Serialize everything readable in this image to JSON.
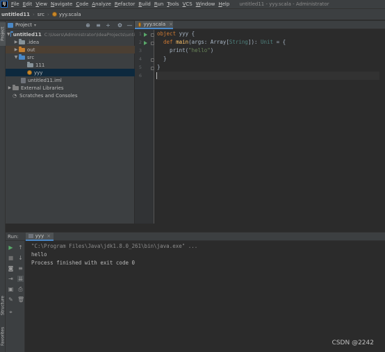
{
  "menubar": {
    "app_icon": "intellij-logo",
    "items": [
      "File",
      "Edit",
      "View",
      "Navigate",
      "Code",
      "Analyze",
      "Refactor",
      "Build",
      "Run",
      "Tools",
      "VCS",
      "Window",
      "Help"
    ],
    "window_title": "untitled11 - yyy.scala - Administrator"
  },
  "breadcrumb": {
    "project": "untitled11",
    "folder": "src",
    "file": "yyy.scala"
  },
  "left_strip": {
    "project_tab": "Project",
    "structure_tab": "Structure",
    "favorites_tab": "Favorites"
  },
  "project_panel": {
    "title": "Project",
    "tree": [
      {
        "label": "untitled11",
        "path": "C:\\Users\\Administrator\\IdeaProjects\\unti"
      },
      {
        "label": ".idea"
      },
      {
        "label": "out"
      },
      {
        "label": "src"
      },
      {
        "label": "111"
      },
      {
        "label": "yyy"
      },
      {
        "label": "untitled11.iml"
      },
      {
        "label": "External Libraries"
      },
      {
        "label": "Scratches and Consoles"
      }
    ]
  },
  "editor": {
    "tab_label": "yyy.scala",
    "line_numbers": [
      "1",
      "2",
      "3",
      "4",
      "5",
      "6"
    ],
    "code": {
      "l1_kw": "object",
      "l1_rest": " yyy {",
      "l2_indent": "  ",
      "l2_kw": "def",
      "l2_sp": " ",
      "l2_fn": "main",
      "l2_a": "(args: Array[",
      "l2_type": "String",
      "l2_b": "]): ",
      "l2_unit": "Unit",
      "l2_c": " = {",
      "l3_a": "    print(",
      "l3_str": "\"hello\"",
      "l3_b": ")",
      "l4": "  }",
      "l5": "}",
      "l6": ""
    }
  },
  "run_panel": {
    "label": "Run:",
    "tab": "yyy",
    "console": {
      "cmd": "\"C:\\Program Files\\Java\\jdk1.8.0_261\\bin\\java.exe\" ...",
      "output": "hello",
      "blank": "",
      "exit": "Process finished with exit code 0"
    }
  },
  "watermark": "CSDN @2242",
  "colors": {
    "keyword": "#cc7832",
    "string": "#6a8759",
    "type": "#4e807d",
    "function": "#ffc66d",
    "selection": "#0d293e",
    "accent": "#4a88c7"
  }
}
